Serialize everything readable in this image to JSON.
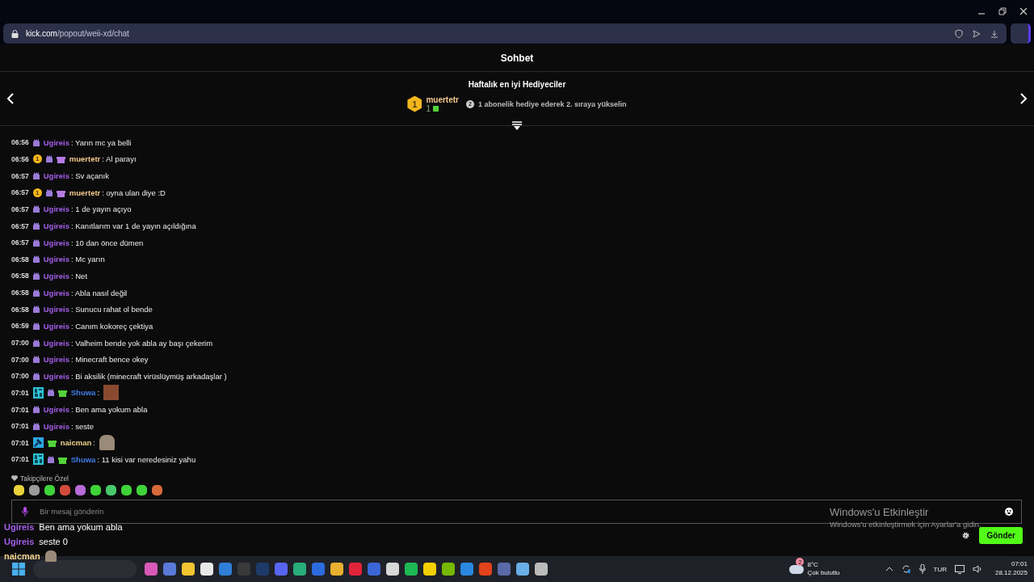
{
  "browser": {
    "url_host": "kick.com",
    "url_path": "/popout/weii-xd/chat"
  },
  "chat_header": {
    "title": "Sohbet"
  },
  "gifters": {
    "title": "Haftalık en iyi Hediyeciler",
    "top": {
      "rank": "1",
      "name": "muertetr",
      "count": "1"
    },
    "hint_rank": "2",
    "hint": "1 abonelik hediye ederek 2. sıraya yükselin"
  },
  "messages": [
    {
      "time": "06:56",
      "badges": [
        {
          "kind": "sub"
        }
      ],
      "user": "Ugireis",
      "color": "#a35ee8",
      "text": ": Yarın mc ya belli"
    },
    {
      "time": "06:56",
      "badges": [
        {
          "kind": "rank",
          "label": "1"
        },
        {
          "kind": "sub"
        },
        {
          "kind": "gift",
          "color": "#b57be6"
        }
      ],
      "user": "muertetr",
      "color": "#f3c98b",
      "text": ": Al parayı"
    },
    {
      "time": "06:57",
      "badges": [
        {
          "kind": "sub"
        }
      ],
      "user": "Ugireis",
      "color": "#a35ee8",
      "text": ": Sv açanık"
    },
    {
      "time": "06:57",
      "badges": [
        {
          "kind": "rank",
          "label": "1"
        },
        {
          "kind": "sub"
        },
        {
          "kind": "gift",
          "color": "#b57be6"
        }
      ],
      "user": "muertetr",
      "color": "#f3c98b",
      "text": ": oyna ulan diye :D"
    },
    {
      "time": "06:57",
      "badges": [
        {
          "kind": "sub"
        }
      ],
      "user": "Ugireis",
      "color": "#a35ee8",
      "text": ": 1 de yayın açıyo"
    },
    {
      "time": "06:57",
      "badges": [
        {
          "kind": "sub"
        }
      ],
      "user": "Ugireis",
      "color": "#a35ee8",
      "text": ": Kanıtlarım var 1 de yayın açıldığına"
    },
    {
      "time": "06:57",
      "badges": [
        {
          "kind": "sub"
        }
      ],
      "user": "Ugireis",
      "color": "#a35ee8",
      "text": ": 10 dan önce dümen"
    },
    {
      "time": "06:58",
      "badges": [
        {
          "kind": "sub"
        }
      ],
      "user": "Ugireis",
      "color": "#a35ee8",
      "text": ": Mc yarın"
    },
    {
      "time": "06:58",
      "badges": [
        {
          "kind": "sub"
        }
      ],
      "user": "Ugireis",
      "color": "#a35ee8",
      "text": ": Net"
    },
    {
      "time": "06:58",
      "badges": [
        {
          "kind": "sub"
        }
      ],
      "user": "Ugireis",
      "color": "#a35ee8",
      "text": ": Abla nasıl değil"
    },
    {
      "time": "06:58",
      "badges": [
        {
          "kind": "sub"
        }
      ],
      "user": "Ugireis",
      "color": "#a35ee8",
      "text": ": Sunucu rahat ol bende"
    },
    {
      "time": "06:59",
      "badges": [
        {
          "kind": "sub"
        }
      ],
      "user": "Ugireis",
      "color": "#a35ee8",
      "text": ": Canım kokoreç çektiya"
    },
    {
      "time": "07:00",
      "badges": [
        {
          "kind": "sub"
        }
      ],
      "user": "Ugireis",
      "color": "#a35ee8",
      "text": ": Valheim bende yok abla ay başı çekerim"
    },
    {
      "time": "07:00",
      "badges": [
        {
          "kind": "sub"
        }
      ],
      "user": "Ugireis",
      "color": "#a35ee8",
      "text": ": Minecraft bence okey"
    },
    {
      "time": "07:00",
      "badges": [
        {
          "kind": "sub"
        }
      ],
      "user": "Ugireis",
      "color": "#a35ee8",
      "text": ": Bi aksilik (minecraft virüslüymüş arkadaşlar )"
    },
    {
      "time": "07:01",
      "badges": [
        {
          "kind": "og"
        },
        {
          "kind": "sub"
        },
        {
          "kind": "gift",
          "color": "#53d23a"
        }
      ],
      "user": "Shuwa",
      "color": "#3f7ee8",
      "text": ":",
      "kind": "photo-emote"
    },
    {
      "time": "07:01",
      "badges": [
        {
          "kind": "sub"
        }
      ],
      "user": "Ugireis",
      "color": "#a35ee8",
      "text": ": Ben ama yokum abla"
    },
    {
      "time": "07:01",
      "badges": [
        {
          "kind": "sub"
        }
      ],
      "user": "Ugireis",
      "color": "#a35ee8",
      "text": ": seste"
    },
    {
      "time": "07:01",
      "badges": [
        {
          "kind": "mod"
        },
        {
          "kind": "gift",
          "color": "#53d23a"
        }
      ],
      "user": "naicman",
      "color": "#f3d48e",
      "text": ":",
      "kind": "cat-emote"
    },
    {
      "time": "07:01",
      "badges": [
        {
          "kind": "og"
        },
        {
          "kind": "sub"
        },
        {
          "kind": "gift",
          "color": "#53d23a"
        }
      ],
      "user": "Shuwa",
      "color": "#3f7ee8",
      "text": ": 11 kisi var neredesiniz yahu"
    }
  ],
  "follower_emotes": {
    "title": "Takipçilere Özel",
    "emotes": [
      {
        "color": "#e8d33a"
      },
      {
        "color": "#9a9a9a"
      },
      {
        "color": "#3fd33a"
      },
      {
        "color": "#d24a3a"
      },
      {
        "color": "#b86ad8"
      },
      {
        "color": "#3fd33a"
      },
      {
        "color": "#47c96a"
      },
      {
        "color": "#3fd33a"
      },
      {
        "color": "#3fd33a"
      },
      {
        "color": "#d86a3a"
      }
    ]
  },
  "input": {
    "placeholder": "Bir mesaj gönderin"
  },
  "send_button": "Gönder",
  "overlay_chat": [
    {
      "user": "Ugireis",
      "color": "#a35ee8",
      "text": "Ben ama yokum abla"
    },
    {
      "user": "Ugireis",
      "color": "#a35ee8",
      "text": "seste 0"
    },
    {
      "user": "naicman",
      "color": "#f3d48e",
      "kind": "cat-emote"
    }
  ],
  "activation": {
    "title": "Windows'u Etkinleştir",
    "text": "Windows'u etkinleştirmek için Ayarlar'a gidin."
  },
  "taskbar": {
    "apps": [
      {
        "color": "#d85ab8"
      },
      {
        "color": "#5a7ad8"
      },
      {
        "color": "#f2c531"
      },
      {
        "color": "#e8e8e8"
      },
      {
        "color": "#2f7fd8"
      },
      {
        "color": "#3a3a3a"
      },
      {
        "color": "#1d3a6a"
      },
      {
        "color": "#5865f2"
      },
      {
        "color": "#27ae7a"
      },
      {
        "color": "#2d6ce0"
      },
      {
        "color": "#e8b030"
      },
      {
        "color": "#e0243a"
      },
      {
        "color": "#3a66d8"
      },
      {
        "color": "#d8d8d8"
      },
      {
        "color": "#1db954"
      },
      {
        "color": "#f5d000"
      },
      {
        "color": "#76b900"
      },
      {
        "color": "#2a88e0"
      },
      {
        "color": "#e2431a"
      },
      {
        "color": "#5a6aa8"
      },
      {
        "color": "#6aaee8"
      },
      {
        "color": "#bbbbbb"
      }
    ],
    "weather": {
      "badge": "2",
      "temp": "8°C",
      "desc": "Çok bulutlu"
    },
    "lang": "TUR",
    "time": "07:01",
    "date": "28.12.2025"
  }
}
